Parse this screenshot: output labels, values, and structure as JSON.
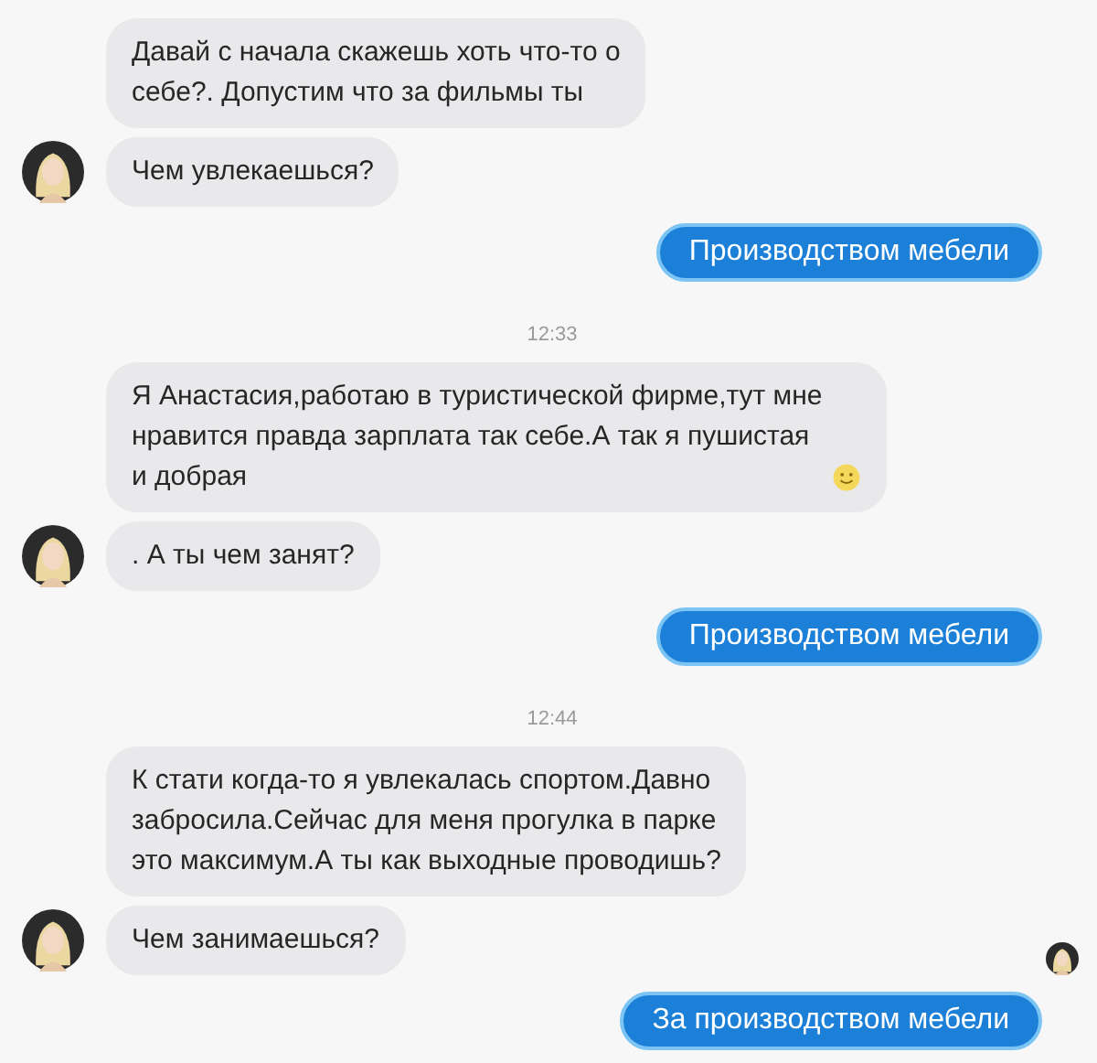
{
  "messages": [
    {
      "kind": "incoming",
      "text": "Давай с начала скажешь хоть что-то о\nсебе?. Допустим что за фильмы ты",
      "avatar": false,
      "emoji": false,
      "seen": false
    },
    {
      "kind": "incoming",
      "text": "Чем увлекаешься?",
      "avatar": true,
      "emoji": false,
      "seen": false
    },
    {
      "kind": "outgoing",
      "text": "Производством мебели"
    },
    {
      "kind": "time",
      "text": "12:33"
    },
    {
      "kind": "incoming",
      "text": "Я Анастасия,работаю в туристической фирме,тут мне\nнравится правда зарплата так себе.А так я пушистая\nи добрая",
      "avatar": false,
      "emoji": true,
      "seen": false
    },
    {
      "kind": "incoming",
      "text": ". А ты чем занят?",
      "avatar": true,
      "emoji": false,
      "seen": false
    },
    {
      "kind": "outgoing",
      "text": "Производством мебели"
    },
    {
      "kind": "time",
      "text": "12:44"
    },
    {
      "kind": "incoming",
      "text": "К стати когда-то я увлекалась спортом.Давно\nзабросила.Сейчас для меня прогулка в парке\nэто максимум.А ты как выходные проводишь?",
      "avatar": false,
      "emoji": false,
      "seen": false
    },
    {
      "kind": "incoming",
      "text": "Чем занимаешься?",
      "avatar": true,
      "emoji": false,
      "seen": true
    },
    {
      "kind": "outgoing",
      "text": "За производством мебели"
    }
  ]
}
